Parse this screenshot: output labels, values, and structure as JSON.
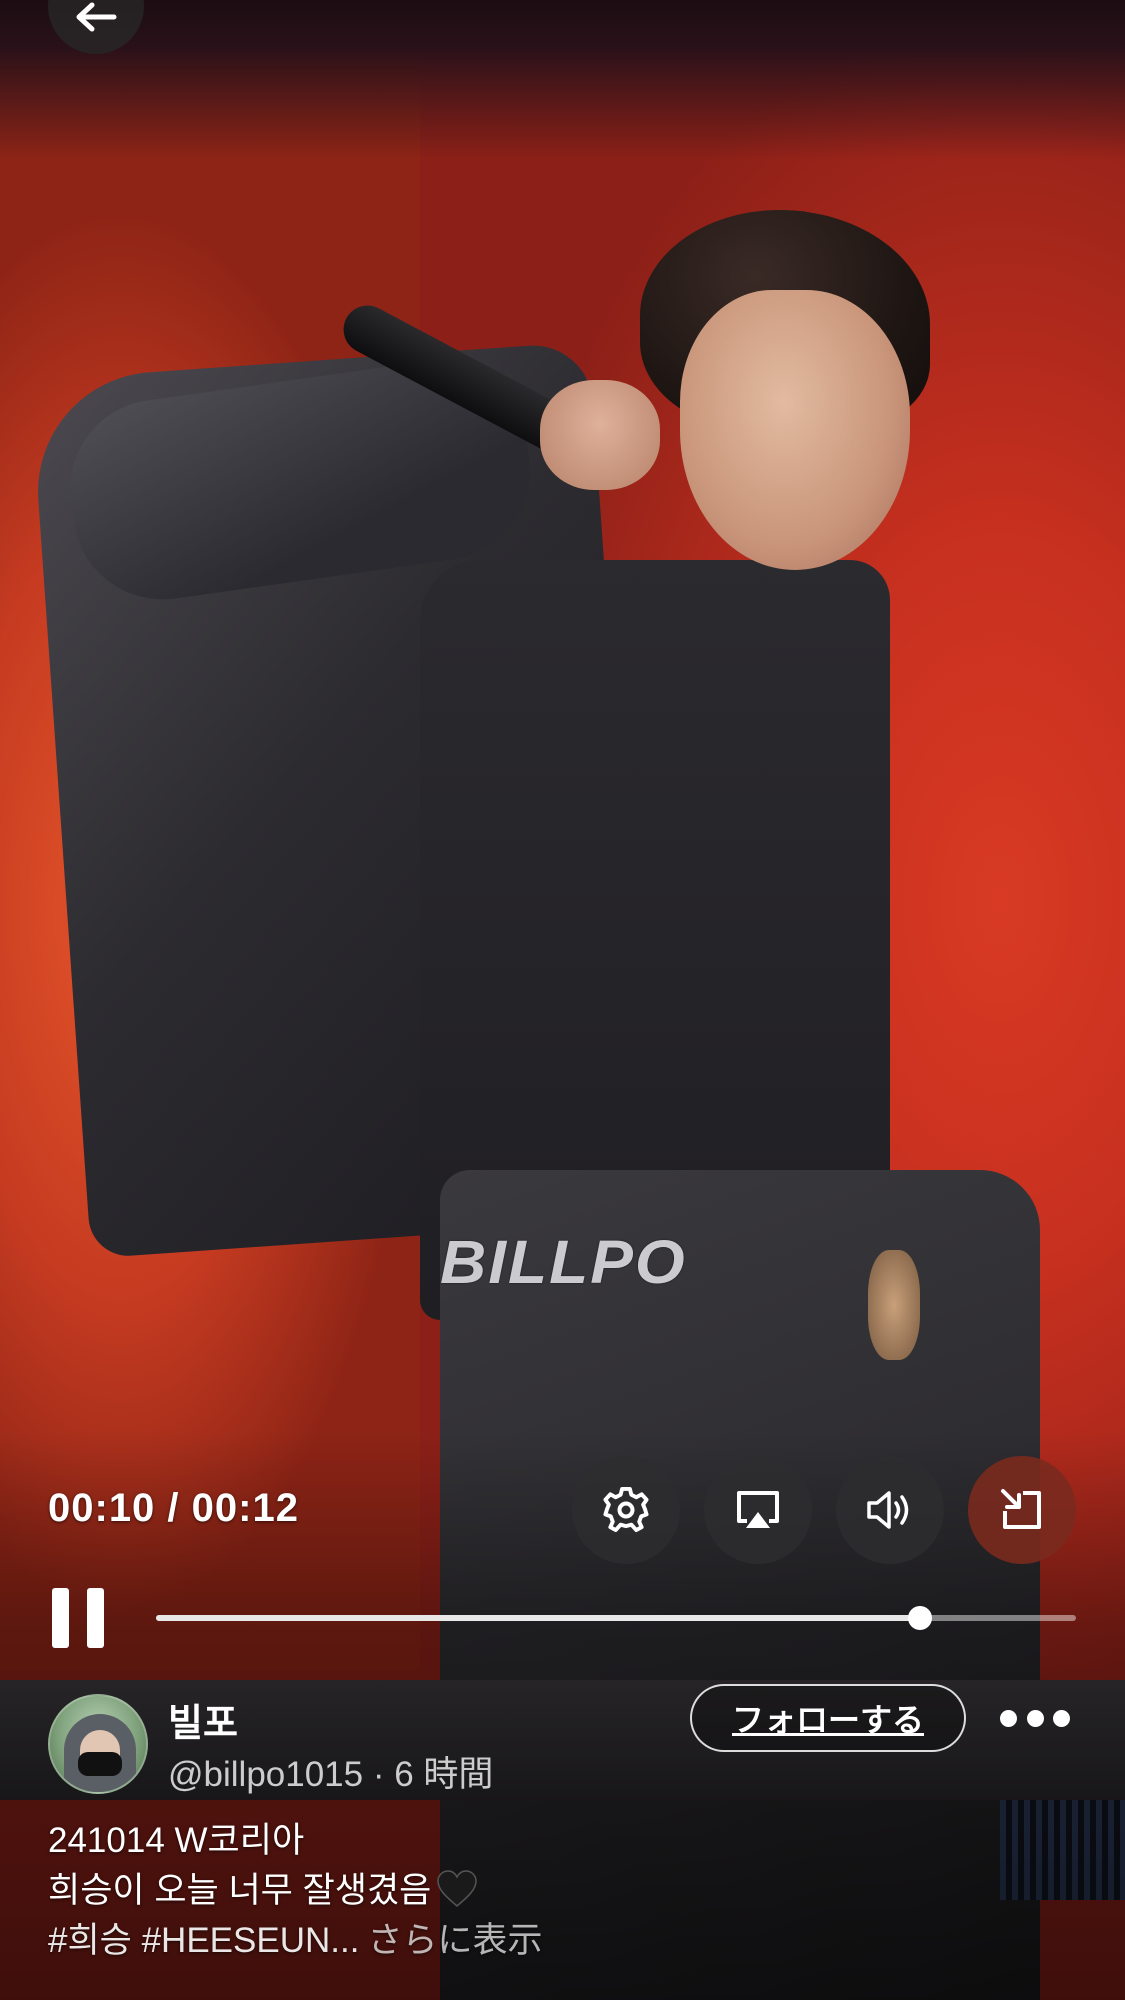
{
  "player": {
    "time_display": "00:10 / 00:12",
    "progress_fraction": 0.83,
    "state": "playing"
  },
  "video": {
    "watermark": "BILLPO"
  },
  "controls": {
    "settings_icon": "gear-icon",
    "airplay_icon": "airplay-icon",
    "volume_icon": "speaker-icon",
    "pip_icon": "picture-in-picture-icon",
    "pip_button_color": "#7a2a1e"
  },
  "author": {
    "display_name": "빌포",
    "handle_time": "@billpo1015 · 6 時間"
  },
  "follow_button": {
    "label": "フォローする"
  },
  "caption": {
    "line1": "241014 W코리아",
    "line2": "희승이 오늘 너무 잘생겼음",
    "line2_emoji": "black-heart-icon",
    "hashtags": "#희승 #HEESEUN...",
    "more_label": "さらに表示"
  }
}
